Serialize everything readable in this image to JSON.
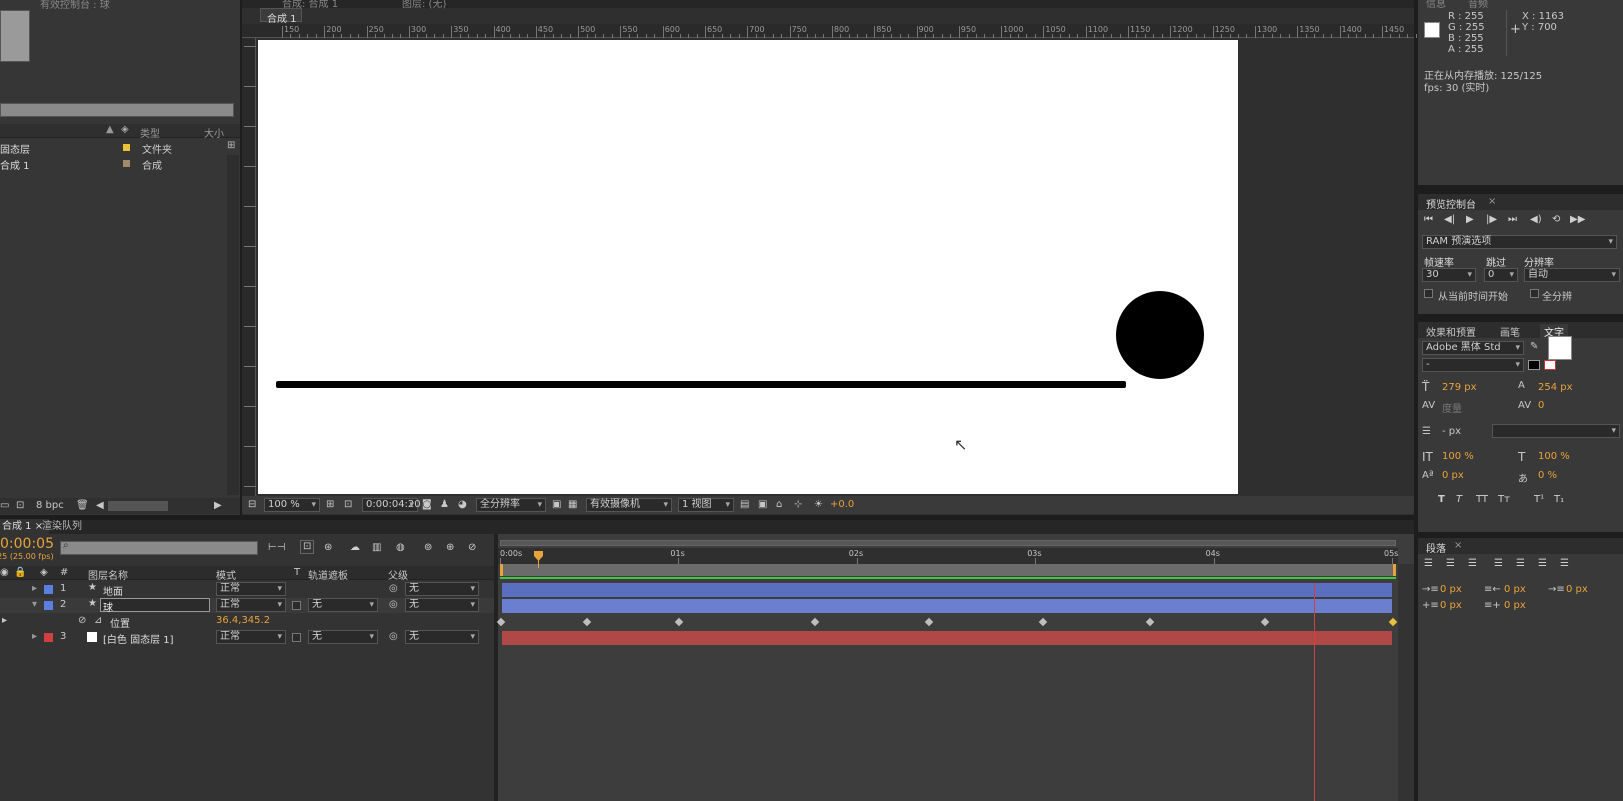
{
  "project": {
    "top_label": "有效控制台 : 球",
    "columns": {
      "type": "类型",
      "size": "大小"
    },
    "items": [
      {
        "name": "固态层",
        "type": "文件夹",
        "color": "#e8c33a"
      },
      {
        "name": "合成 1",
        "type": "合成",
        "color": "#a08a6a"
      }
    ],
    "bpc": "8 bpc"
  },
  "comp_viewer": {
    "tabs": [
      "合成: 合成 1",
      "图层: (无)"
    ],
    "subtab": "合成 1",
    "ruler_labels": [
      "150",
      "200",
      "250",
      "300",
      "350",
      "400",
      "450",
      "500",
      "550",
      "600",
      "650",
      "700",
      "750",
      "800",
      "850",
      "900",
      "950",
      "1000",
      "1050",
      "1100",
      "1150",
      "1200",
      "1250",
      "1300",
      "1350",
      "1400",
      "1450"
    ],
    "zoom": "100 %",
    "timecode": "0:00:04:20",
    "resolution": "全分辨率",
    "camera": "有效摄像机",
    "views": "1 视图",
    "exposure": "+0.0"
  },
  "info": {
    "tabs": [
      "信息",
      "音频"
    ],
    "r": "R : 255",
    "g": "G : 255",
    "b": "B : 255",
    "a": "A : 255",
    "x": "X : 1163",
    "y": "Y : 700",
    "status": "正在从内存播放: 125/125",
    "fps": "fps: 30 (实时)"
  },
  "preview": {
    "title": "预览控制台",
    "ram_options": "RAM 预演选项",
    "frame_rate_label": "帧速率",
    "skip_label": "跳过",
    "resolution_label": "分辨率",
    "frame_rate": "30",
    "skip": "0",
    "resolution": "自动",
    "from_current": "从当前时间开始",
    "full_screen": "全分辨"
  },
  "character": {
    "tabs": [
      "效果和预置",
      "画笔",
      "文字"
    ],
    "font": "Adobe 黑体 Std",
    "style": "-",
    "size": "279 px",
    "leading": "254 px",
    "kerning": "度量",
    "tracking": "0",
    "stroke": "- px",
    "vscale": "100 %",
    "hscale": "100 %",
    "baseline": "0 px",
    "tsume": "0 %"
  },
  "paragraph": {
    "title": "段落",
    "indent_left": "0 px",
    "indent_right": "0 px",
    "indent_first": "0 px",
    "space_before": "0 px",
    "space_after": "0 px"
  },
  "timeline": {
    "tabs": [
      "合成 1",
      "渲染队列"
    ],
    "timecode": "0:00:05",
    "fps": "125 (25.00 fps)",
    "columns": {
      "num": "#",
      "name": "图层名称",
      "mode": "模式",
      "t": "T",
      "trkmat": "轨道遮板",
      "parent": "父级"
    },
    "ruler": [
      "0:00s",
      "01s",
      "02s",
      "03s",
      "04s",
      "05s"
    ],
    "layers": [
      {
        "num": "1",
        "name": "地面",
        "mode": "正常",
        "trkmat": "",
        "parent": "无",
        "label": "#5b7fe0"
      },
      {
        "num": "2",
        "name": "球",
        "mode": "正常",
        "trkmat": "无",
        "parent": "无",
        "label": "#5b7fe0"
      },
      {
        "num": "3",
        "name": "[白色 固态层 1]",
        "mode": "正常",
        "trkmat": "无",
        "parent": "无",
        "label": "#d04040"
      }
    ],
    "position_label": "位置",
    "position_value": "36.4,345.2",
    "colors": {
      "bar_blue": "#5a6fc0",
      "bar_red": "#b04848",
      "playhead": "#e8a33a"
    }
  }
}
